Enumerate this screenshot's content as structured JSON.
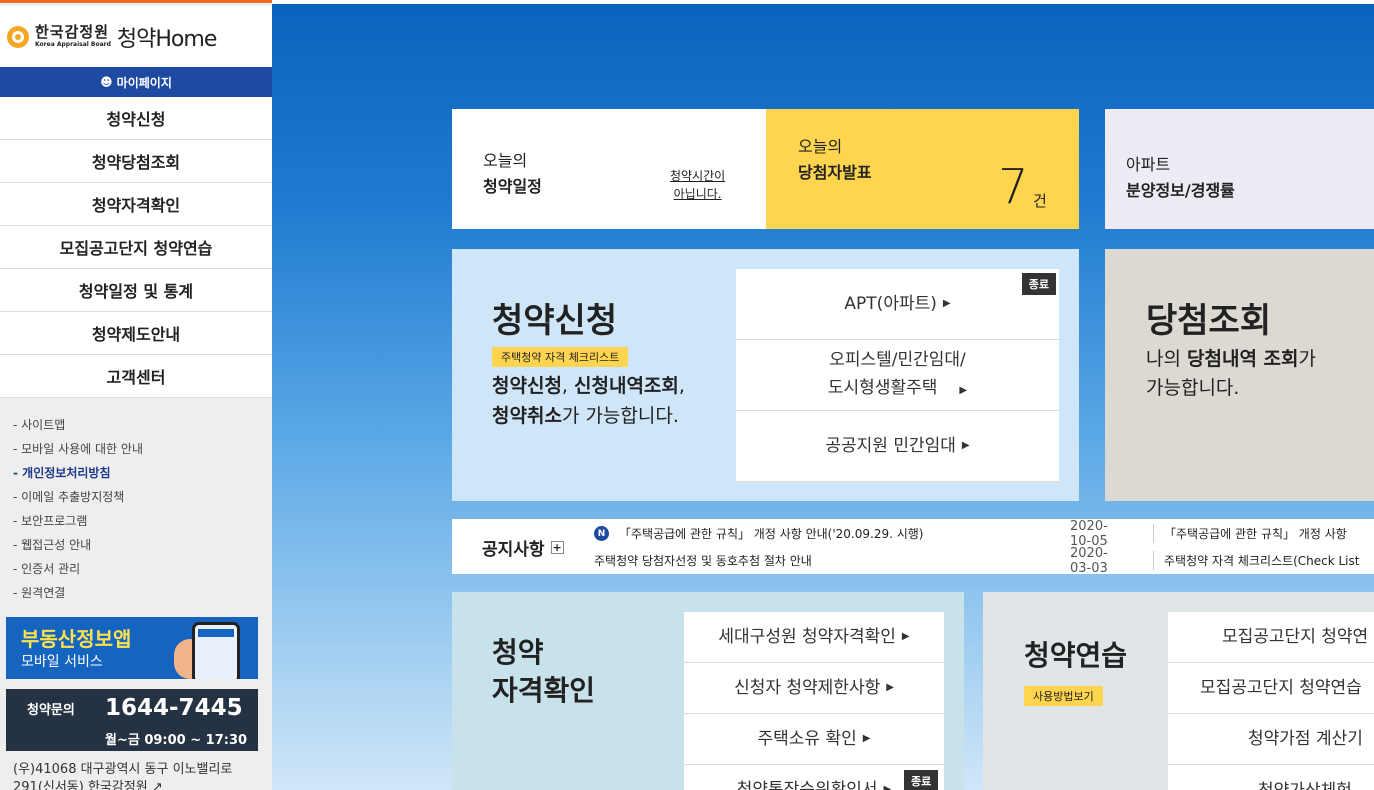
{
  "logo": {
    "korean": "한국감정원",
    "english": "Korea Appraisal Board",
    "brand": "청약Home"
  },
  "mypage": {
    "label": "마이페이지"
  },
  "menu": [
    {
      "label": "청약신청"
    },
    {
      "label": "청약당첨조회"
    },
    {
      "label": "청약자격확인"
    },
    {
      "label": "모집공고단지 청약연습"
    },
    {
      "label": "청약일정 및 통계"
    },
    {
      "label": "청약제도안내"
    },
    {
      "label": "고객센터"
    }
  ],
  "links": [
    {
      "label": "- 사이트맵"
    },
    {
      "label": "- 모바일 사용에 대한 안내"
    },
    {
      "label": "- 개인정보처리방침"
    },
    {
      "label": "- 이메일 추출방지정책"
    },
    {
      "label": "- 보안프로그램"
    },
    {
      "label": "- 웹접근성 안내"
    },
    {
      "label": "- 인증서 관리"
    },
    {
      "label": "- 원격연결"
    }
  ],
  "app_banner": {
    "title": "부동산정보앱",
    "subtitle": "모바일 서비스"
  },
  "call_banner": {
    "label": "청약문의",
    "number": "1644-7445",
    "hours": "월~금 09:00 ~ 17:30"
  },
  "address": {
    "line1": "(우)41068 대구광역시 동구 이노밸리로",
    "line2": "291(신서동) 한국감정원 ↗"
  },
  "today_schedule": {
    "small": "오늘의",
    "bold": "청약일정",
    "status_line1": "청약시간이",
    "status_line2": "아닙니다."
  },
  "today_winner": {
    "small": "오늘의",
    "bold": "당첨자발표",
    "count": "7",
    "unit": "건"
  },
  "apt_info": {
    "small": "아파트",
    "bold": "분양정보/경쟁률"
  },
  "apply": {
    "title": "청약신청",
    "badge": "주택청약 자격 체크리스트",
    "desc_b1": "청약신청",
    "desc_t1": ", ",
    "desc_b2": "신청내역조회",
    "desc_t2": ",",
    "desc_b3": "청약취소",
    "desc_t3": "가 가능합니다.",
    "closed": "종료",
    "options": [
      {
        "label": "APT(아파트)"
      },
      {
        "label": "오피스텔/민간임대/",
        "label2": "도시형생활주택"
      },
      {
        "label": "공공지원 민간임대"
      }
    ]
  },
  "winner_check": {
    "title": "당첨조회",
    "desc_t1": "나의 ",
    "desc_b1": "당첨내역 조회",
    "desc_t2": "가",
    "desc_t3": "가능합니다."
  },
  "notice": {
    "title": "공지사항",
    "plus": "+",
    "new_icon": "N",
    "items": [
      {
        "title": "「주택공급에 관한 규칙」 개정 사항 안내('20.09.29. 시행)",
        "date": "2020-10-05",
        "right": "「주택공급에 관한 규칙」 개정 사항"
      },
      {
        "title": "주택청약 당첨자선정 및 동호추첨 절차 안내",
        "date": "2020-03-03",
        "right": "주택청약 자격 체크리스트(Check List"
      }
    ]
  },
  "qualify": {
    "title_line1": "청약",
    "title_line2": "자격확인",
    "closed": "종료",
    "options": [
      {
        "label": "세대구성원 청약자격확인"
      },
      {
        "label": "신청자 청약제한사항"
      },
      {
        "label": "주택소유 확인"
      },
      {
        "label": "청약통장순위확인서"
      }
    ]
  },
  "practice": {
    "title": "청약연습",
    "badge": "사용방법보기",
    "options": [
      {
        "label": "모집공고단지 청약연"
      },
      {
        "label": "모집공고단지 청약연습"
      },
      {
        "label": "청약가점 계산기"
      },
      {
        "label": "청약가상체험"
      }
    ]
  }
}
